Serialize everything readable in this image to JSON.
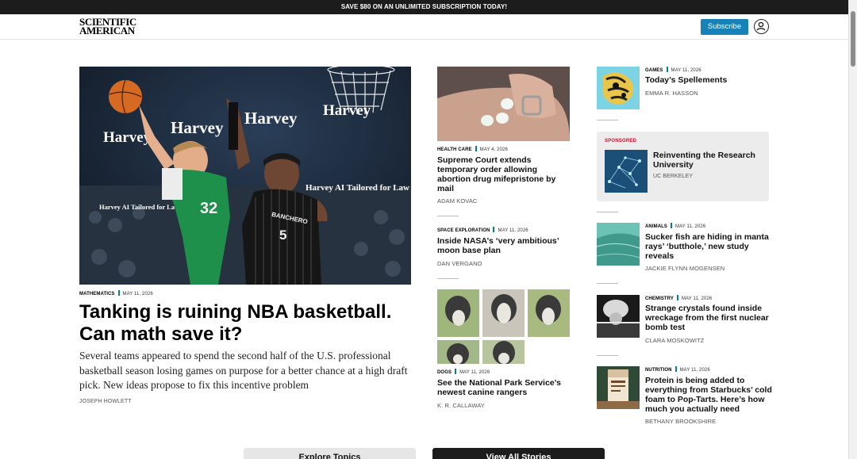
{
  "promo": {
    "text": "SAVE $80 ON AN UNLIMITED SUBSCRIPTION TODAY!"
  },
  "header": {
    "logo_line1": "SCIENTIFIC",
    "logo_line2": "AMERICAN",
    "subscribe_label": "Subscribe",
    "account_icon": "user-circle-icon"
  },
  "lead": {
    "category": "MATHEMATICS",
    "date": "MAY 11, 2026",
    "title": "Tanking is ruining NBA basketball. Can math save it?",
    "dek": "Several teams appeared to spend the second half of the U.S. professional basketball season losing games on purpose for a better chance at a high draft pick. New ideas propose to fix this incentive problem",
    "author": "JOSEPH HOWLETT",
    "image_text": {
      "harvey": "Harvey",
      "harvey_ai": "Harvey AI Tailored for Law",
      "jersey_green_number": "32",
      "jersey_dark_name": "BANCHERO",
      "jersey_dark_number": "5"
    }
  },
  "middle": [
    {
      "category": "HEALTH CARE",
      "date": "MAY 4, 2026",
      "title": "Supreme Court extends temporary order allowing abortion drug mifepristone by mail",
      "author": "ADAM KOVAC"
    },
    {
      "category": "SPACE EXPLORATION",
      "date": "MAY 11, 2026",
      "title": "Inside NASA’s ‘very ambitious’ moon base plan",
      "author": "DAN VERGANO"
    },
    {
      "category": "DOGS",
      "date": "MAY 11, 2026",
      "title": "See the National Park Service’s newest canine rangers",
      "author": "K. R. CALLAWAY"
    }
  ],
  "right": {
    "games": {
      "category": "GAMES",
      "date": "MAY 11, 2026",
      "title": "Today’s Spellements",
      "author": "EMMA R. HASSON"
    },
    "sponsored": {
      "tag": "SPONSORED",
      "title": "Reinventing the Research University",
      "author": "UC BERKELEY"
    },
    "items": [
      {
        "category": "ANIMALS",
        "date": "MAY 11, 2026",
        "title": "Sucker fish are hiding in manta rays’ ‘butthole,’ new study reveals",
        "author": "JACKIE FLYNN MOGENSEN"
      },
      {
        "category": "CHEMISTRY",
        "date": "MAY 11, 2026",
        "title": "Strange crystals found inside wreckage from the first nuclear bomb test",
        "author": "CLARA MOSKOWITZ"
      },
      {
        "category": "NUTRITION",
        "date": "MAY 11, 2026",
        "title": "Protein is being added to everything from Starbucks’ cold foam to Pop-Tarts. Here’s how much you actually need",
        "author": "BETHANY BROOKSHIRE"
      }
    ]
  },
  "footer_buttons": {
    "explore": "Explore Topics",
    "view_all": "View All Stories"
  },
  "colors": {
    "accent": "#1682b8",
    "category_bar": "#0e7c86",
    "sponsored_red": "#c8102e",
    "banner": "#1c1c1c"
  }
}
